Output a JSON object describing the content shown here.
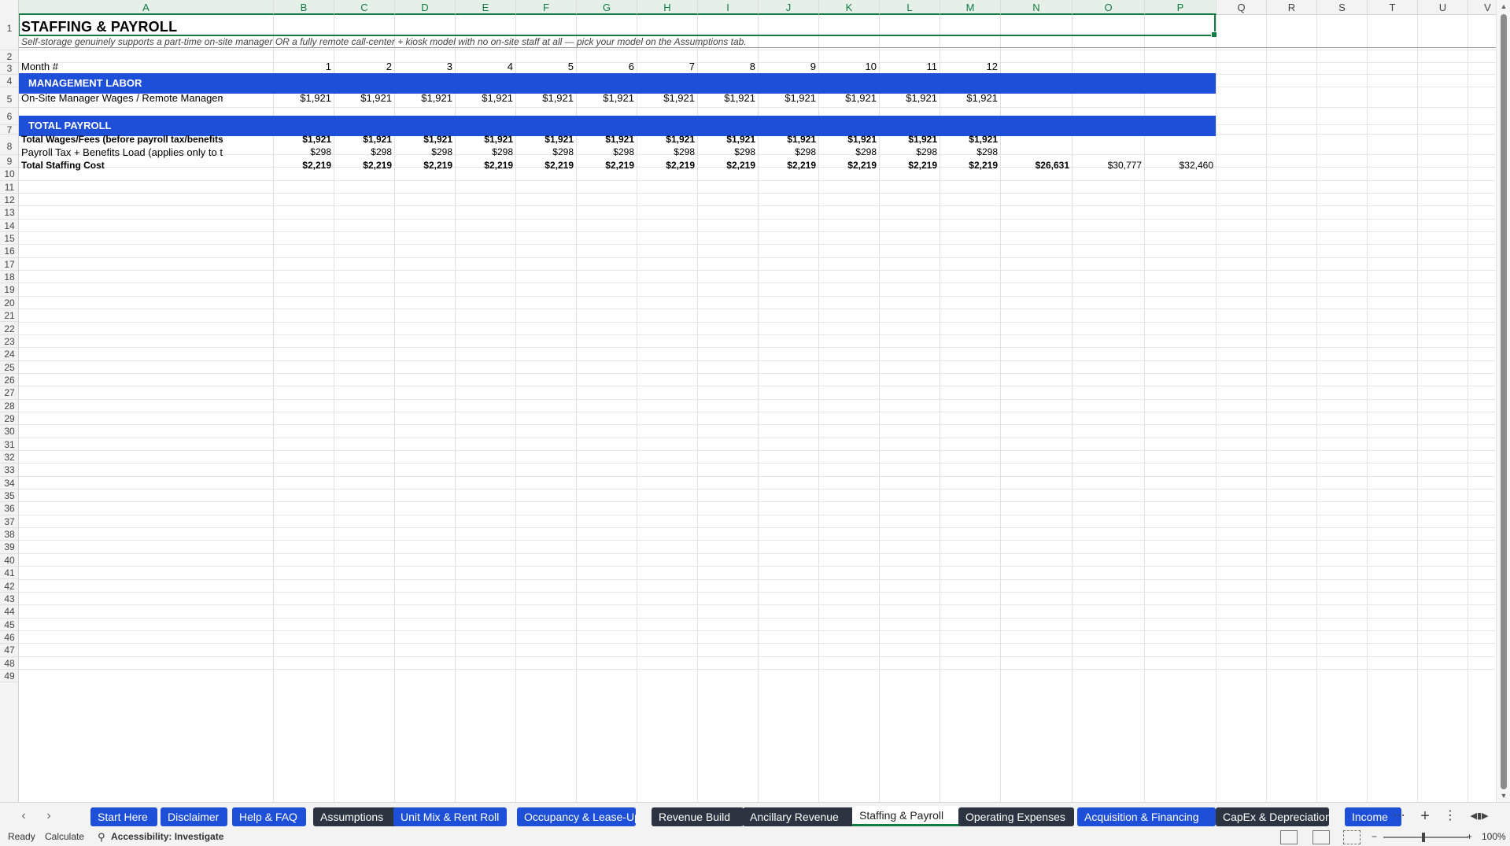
{
  "columns": [
    "A",
    "B",
    "C",
    "D",
    "E",
    "F",
    "G",
    "H",
    "I",
    "J",
    "K",
    "L",
    "M",
    "N",
    "O",
    "P",
    "Q",
    "R",
    "S",
    "T",
    "U",
    "V"
  ],
  "sheet": {
    "title": "STAFFING & PAYROLL",
    "subtitle": "Self-storage genuinely supports a part-time on-site manager OR a fully remote call-center + kiosk model with no on-site staff at all — pick your model on the Assumptions tab.",
    "month_label": "Month #",
    "months": [
      "1",
      "2",
      "3",
      "4",
      "5",
      "6",
      "7",
      "8",
      "9",
      "10",
      "11",
      "12"
    ],
    "section_management": "MANAGEMENT LABOR",
    "row6_label": "On-Site Manager Wages / Remote Management Fee",
    "row6_values": [
      "$1,921",
      "$1,921",
      "$1,921",
      "$1,921",
      "$1,921",
      "$1,921",
      "$1,921",
      "$1,921",
      "$1,921",
      "$1,921",
      "$1,921",
      "$1,921"
    ],
    "section_total": "TOTAL PAYROLL",
    "row9_label": "Total Wages/Fees (before payroll tax/benefits load)",
    "row9_values": [
      "$1,921",
      "$1,921",
      "$1,921",
      "$1,921",
      "$1,921",
      "$1,921",
      "$1,921",
      "$1,921",
      "$1,921",
      "$1,921",
      "$1,921",
      "$1,921"
    ],
    "row10_label": "Payroll Tax + Benefits Load (applies only to the on-site",
    "row10_values": [
      "$298",
      "$298",
      "$298",
      "$298",
      "$298",
      "$298",
      "$298",
      "$298",
      "$298",
      "$298",
      "$298",
      "$298"
    ],
    "row11_label": "Total Staffing Cost",
    "row11_values": [
      "$2,219",
      "$2,219",
      "$2,219",
      "$2,219",
      "$2,219",
      "$2,219",
      "$2,219",
      "$2,219",
      "$2,219",
      "$2,219",
      "$2,219",
      "$2,219"
    ],
    "row11_annual": [
      "$26,631",
      "$30,777",
      "$32,460"
    ]
  },
  "tabs": [
    {
      "label": "Start Here",
      "style": "blue"
    },
    {
      "label": "Disclaimer",
      "style": "blue"
    },
    {
      "label": "Help & FAQ",
      "style": "blue"
    },
    {
      "label": "Assumptions",
      "style": "dark"
    },
    {
      "label": "Unit Mix & Rent Roll",
      "style": "blue"
    },
    {
      "label": "Occupancy & Lease-Up",
      "style": "blue"
    },
    {
      "label": "Revenue Build",
      "style": "dark"
    },
    {
      "label": "Ancillary Revenue",
      "style": "dark"
    },
    {
      "label": "Staffing & Payroll",
      "style": "active"
    },
    {
      "label": "Operating Expenses",
      "style": "dark"
    },
    {
      "label": "Acquisition & Financing",
      "style": "blue"
    },
    {
      "label": "CapEx & Depreciation",
      "style": "dark"
    },
    {
      "label": "Income",
      "style": "blue"
    }
  ],
  "status": {
    "ready": "Ready",
    "calculate": "Calculate",
    "accessibility": "Accessibility: Investigate",
    "zoom": "100%"
  },
  "colors": {
    "band": "#1e4fd8",
    "dark_tab": "#2b3440",
    "select": "#107c41"
  }
}
